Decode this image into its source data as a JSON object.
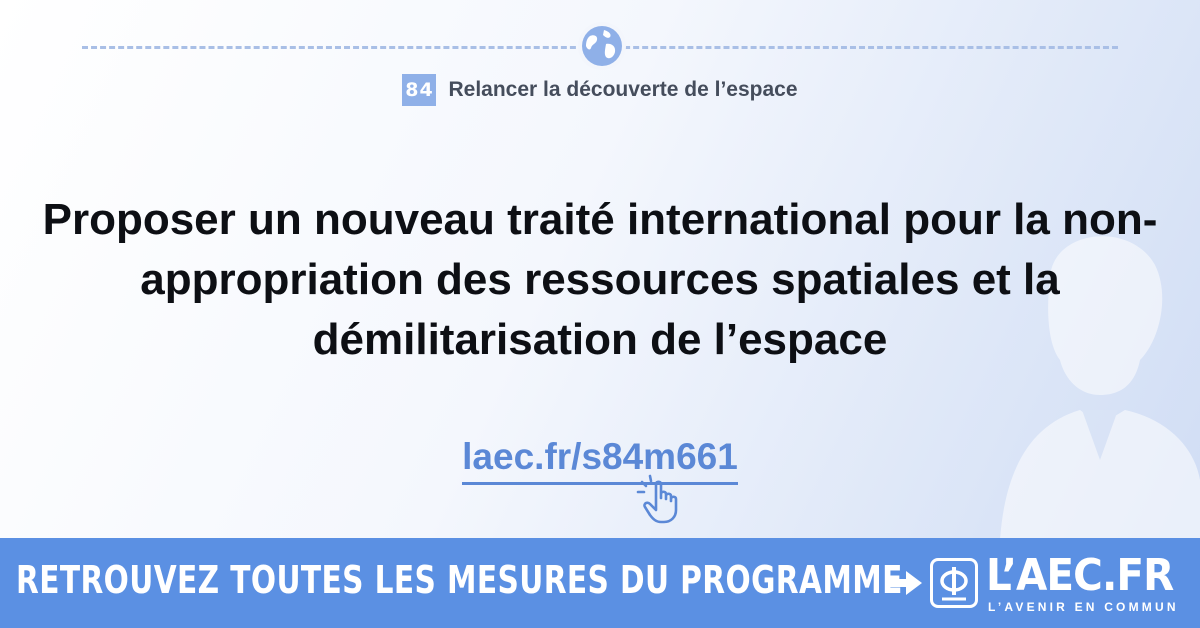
{
  "header": {
    "badge_number": "84",
    "theme_title": "Relancer la découverte de l’espace",
    "icon": "globe-icon"
  },
  "main": {
    "headline": "Proposer un nouveau traité international pour la non-appropriation des ressources spatiales et la démilitarisation de l’espace",
    "link_text": "laec.fr/s84m661",
    "link_icon": "pointing-hand-icon"
  },
  "banner": {
    "cta_text": "RETROUVEZ TOUTES LES MESURES DU PROGRAMME",
    "arrow_icon": "arrow-right-icon",
    "brand_name": "L’AEC.FR",
    "brand_tagline": "L’AVENIR EN COMMUN"
  },
  "colors": {
    "accent": "#5b90e3",
    "link": "#5b88d6",
    "badge": "#8fb0e8",
    "text": "#0d0f14"
  }
}
